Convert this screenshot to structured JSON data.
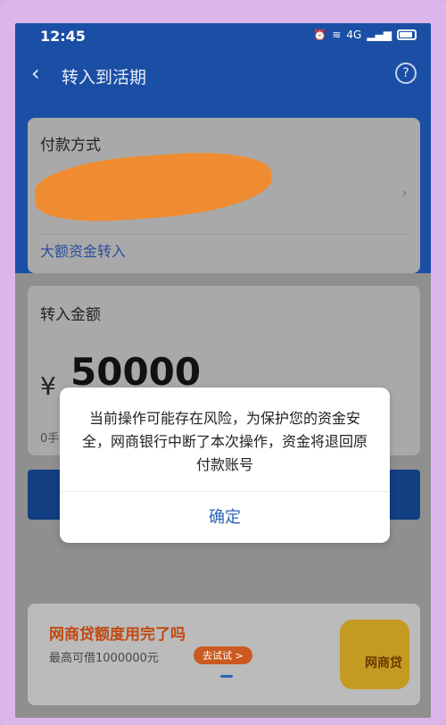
{
  "status": {
    "time": "12:45",
    "signal": "4G",
    "battery": "battery"
  },
  "header": {
    "title": "转入到活期",
    "help": "?"
  },
  "payment": {
    "label": "付款方式",
    "large_transfer": "大额资金转入"
  },
  "amount": {
    "label": "转入金额",
    "currency": "¥",
    "value": "50000",
    "tiny_left": "0手"
  },
  "promo": {
    "title": "网商贷额度用完了吗",
    "subtitle": "最高可借1000000元",
    "tag": "去试试 >",
    "mascot_label": "网商贷"
  },
  "dialog": {
    "message": "当前操作可能存在风险，为保护您的资金安全，网商银行中断了本次操作，资金将退回原付款账号",
    "confirm": "确定"
  }
}
